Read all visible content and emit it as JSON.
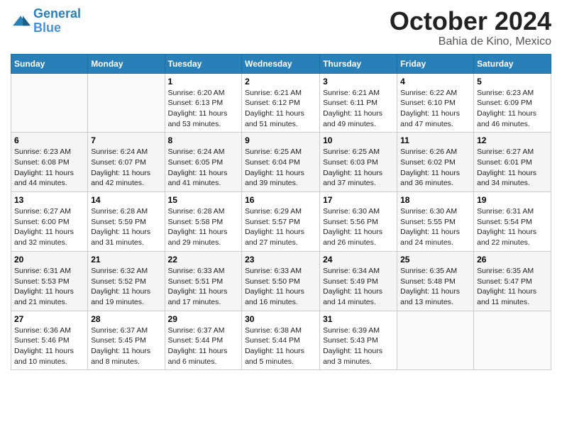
{
  "logo": {
    "line1": "General",
    "line2": "Blue"
  },
  "title": "October 2024",
  "location": "Bahia de Kino, Mexico",
  "days_of_week": [
    "Sunday",
    "Monday",
    "Tuesday",
    "Wednesday",
    "Thursday",
    "Friday",
    "Saturday"
  ],
  "weeks": [
    [
      null,
      null,
      {
        "day": "1",
        "sunrise": "Sunrise: 6:20 AM",
        "sunset": "Sunset: 6:13 PM",
        "daylight": "Daylight: 11 hours and 53 minutes."
      },
      {
        "day": "2",
        "sunrise": "Sunrise: 6:21 AM",
        "sunset": "Sunset: 6:12 PM",
        "daylight": "Daylight: 11 hours and 51 minutes."
      },
      {
        "day": "3",
        "sunrise": "Sunrise: 6:21 AM",
        "sunset": "Sunset: 6:11 PM",
        "daylight": "Daylight: 11 hours and 49 minutes."
      },
      {
        "day": "4",
        "sunrise": "Sunrise: 6:22 AM",
        "sunset": "Sunset: 6:10 PM",
        "daylight": "Daylight: 11 hours and 47 minutes."
      },
      {
        "day": "5",
        "sunrise": "Sunrise: 6:23 AM",
        "sunset": "Sunset: 6:09 PM",
        "daylight": "Daylight: 11 hours and 46 minutes."
      }
    ],
    [
      {
        "day": "6",
        "sunrise": "Sunrise: 6:23 AM",
        "sunset": "Sunset: 6:08 PM",
        "daylight": "Daylight: 11 hours and 44 minutes."
      },
      {
        "day": "7",
        "sunrise": "Sunrise: 6:24 AM",
        "sunset": "Sunset: 6:07 PM",
        "daylight": "Daylight: 11 hours and 42 minutes."
      },
      {
        "day": "8",
        "sunrise": "Sunrise: 6:24 AM",
        "sunset": "Sunset: 6:05 PM",
        "daylight": "Daylight: 11 hours and 41 minutes."
      },
      {
        "day": "9",
        "sunrise": "Sunrise: 6:25 AM",
        "sunset": "Sunset: 6:04 PM",
        "daylight": "Daylight: 11 hours and 39 minutes."
      },
      {
        "day": "10",
        "sunrise": "Sunrise: 6:25 AM",
        "sunset": "Sunset: 6:03 PM",
        "daylight": "Daylight: 11 hours and 37 minutes."
      },
      {
        "day": "11",
        "sunrise": "Sunrise: 6:26 AM",
        "sunset": "Sunset: 6:02 PM",
        "daylight": "Daylight: 11 hours and 36 minutes."
      },
      {
        "day": "12",
        "sunrise": "Sunrise: 6:27 AM",
        "sunset": "Sunset: 6:01 PM",
        "daylight": "Daylight: 11 hours and 34 minutes."
      }
    ],
    [
      {
        "day": "13",
        "sunrise": "Sunrise: 6:27 AM",
        "sunset": "Sunset: 6:00 PM",
        "daylight": "Daylight: 11 hours and 32 minutes."
      },
      {
        "day": "14",
        "sunrise": "Sunrise: 6:28 AM",
        "sunset": "Sunset: 5:59 PM",
        "daylight": "Daylight: 11 hours and 31 minutes."
      },
      {
        "day": "15",
        "sunrise": "Sunrise: 6:28 AM",
        "sunset": "Sunset: 5:58 PM",
        "daylight": "Daylight: 11 hours and 29 minutes."
      },
      {
        "day": "16",
        "sunrise": "Sunrise: 6:29 AM",
        "sunset": "Sunset: 5:57 PM",
        "daylight": "Daylight: 11 hours and 27 minutes."
      },
      {
        "day": "17",
        "sunrise": "Sunrise: 6:30 AM",
        "sunset": "Sunset: 5:56 PM",
        "daylight": "Daylight: 11 hours and 26 minutes."
      },
      {
        "day": "18",
        "sunrise": "Sunrise: 6:30 AM",
        "sunset": "Sunset: 5:55 PM",
        "daylight": "Daylight: 11 hours and 24 minutes."
      },
      {
        "day": "19",
        "sunrise": "Sunrise: 6:31 AM",
        "sunset": "Sunset: 5:54 PM",
        "daylight": "Daylight: 11 hours and 22 minutes."
      }
    ],
    [
      {
        "day": "20",
        "sunrise": "Sunrise: 6:31 AM",
        "sunset": "Sunset: 5:53 PM",
        "daylight": "Daylight: 11 hours and 21 minutes."
      },
      {
        "day": "21",
        "sunrise": "Sunrise: 6:32 AM",
        "sunset": "Sunset: 5:52 PM",
        "daylight": "Daylight: 11 hours and 19 minutes."
      },
      {
        "day": "22",
        "sunrise": "Sunrise: 6:33 AM",
        "sunset": "Sunset: 5:51 PM",
        "daylight": "Daylight: 11 hours and 17 minutes."
      },
      {
        "day": "23",
        "sunrise": "Sunrise: 6:33 AM",
        "sunset": "Sunset: 5:50 PM",
        "daylight": "Daylight: 11 hours and 16 minutes."
      },
      {
        "day": "24",
        "sunrise": "Sunrise: 6:34 AM",
        "sunset": "Sunset: 5:49 PM",
        "daylight": "Daylight: 11 hours and 14 minutes."
      },
      {
        "day": "25",
        "sunrise": "Sunrise: 6:35 AM",
        "sunset": "Sunset: 5:48 PM",
        "daylight": "Daylight: 11 hours and 13 minutes."
      },
      {
        "day": "26",
        "sunrise": "Sunrise: 6:35 AM",
        "sunset": "Sunset: 5:47 PM",
        "daylight": "Daylight: 11 hours and 11 minutes."
      }
    ],
    [
      {
        "day": "27",
        "sunrise": "Sunrise: 6:36 AM",
        "sunset": "Sunset: 5:46 PM",
        "daylight": "Daylight: 11 hours and 10 minutes."
      },
      {
        "day": "28",
        "sunrise": "Sunrise: 6:37 AM",
        "sunset": "Sunset: 5:45 PM",
        "daylight": "Daylight: 11 hours and 8 minutes."
      },
      {
        "day": "29",
        "sunrise": "Sunrise: 6:37 AM",
        "sunset": "Sunset: 5:44 PM",
        "daylight": "Daylight: 11 hours and 6 minutes."
      },
      {
        "day": "30",
        "sunrise": "Sunrise: 6:38 AM",
        "sunset": "Sunset: 5:44 PM",
        "daylight": "Daylight: 11 hours and 5 minutes."
      },
      {
        "day": "31",
        "sunrise": "Sunrise: 6:39 AM",
        "sunset": "Sunset: 5:43 PM",
        "daylight": "Daylight: 11 hours and 3 minutes."
      },
      null,
      null
    ]
  ]
}
